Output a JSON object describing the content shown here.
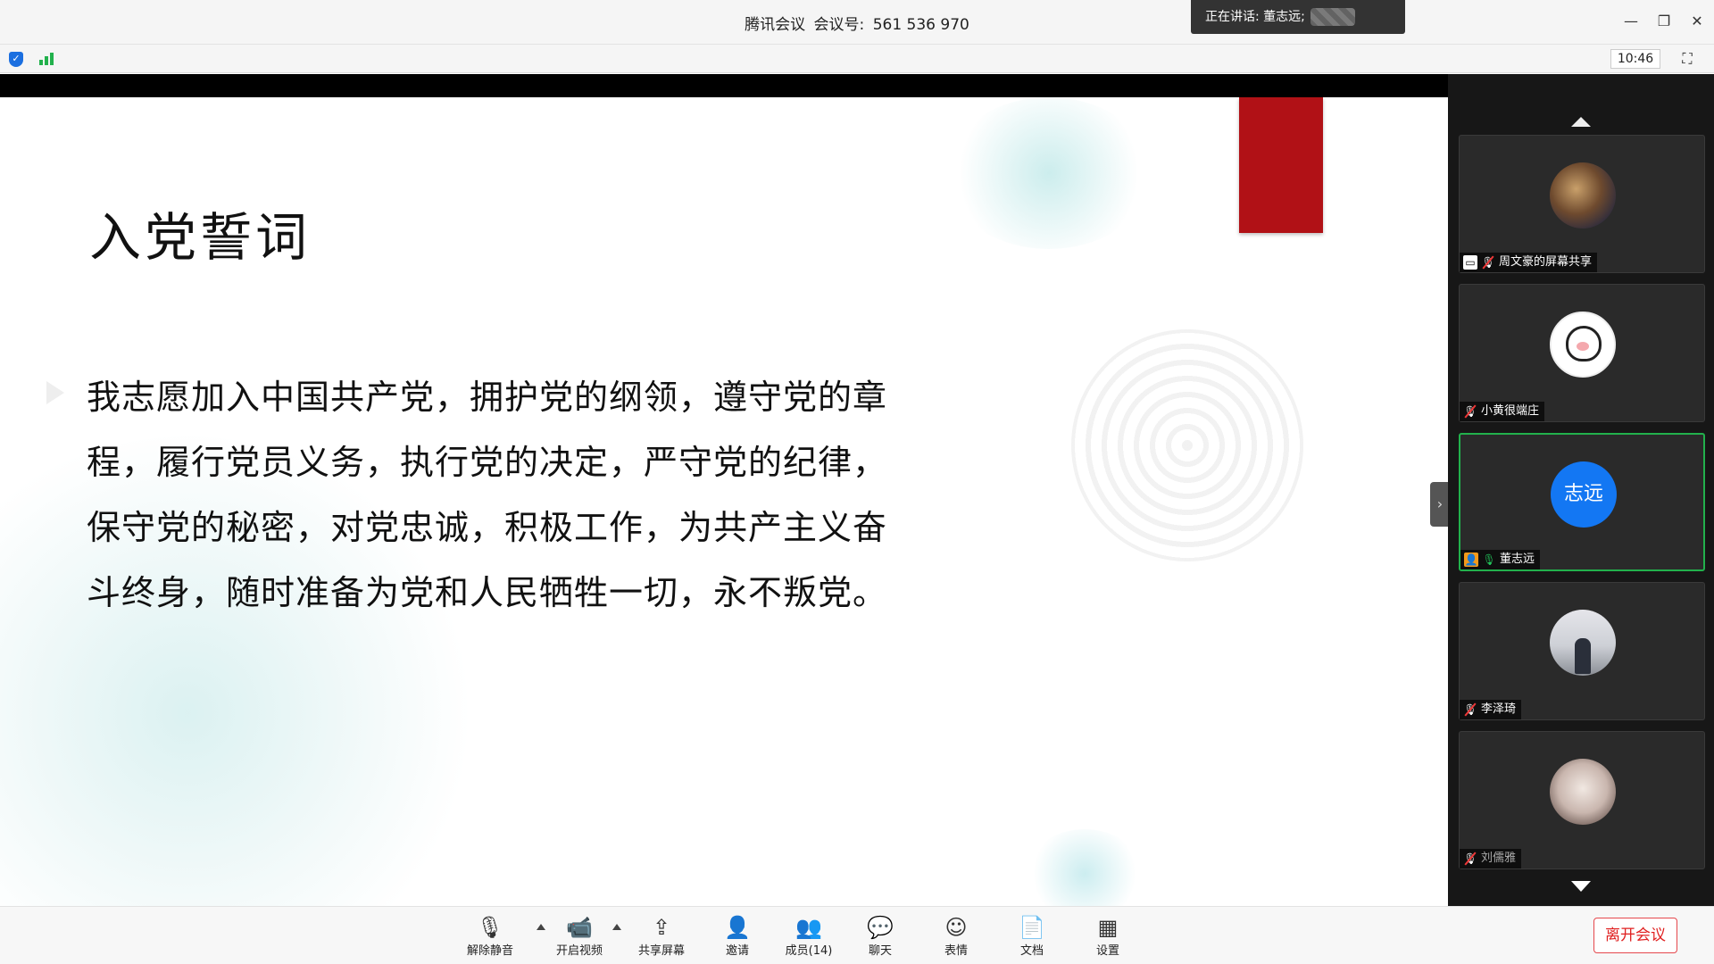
{
  "window": {
    "app_name": "腾讯会议",
    "meeting_label": "会议号:",
    "meeting_id": "561 536 970",
    "speaking_label": "正在讲话: 董志远;",
    "minimize": "—",
    "restore": "❐",
    "close": "✕"
  },
  "infobar": {
    "time": "10:46",
    "fullscreen_icon": "⛶"
  },
  "slide": {
    "title": "入党誓词",
    "body_lines": [
      "我志愿加入中国共产党，拥护党的纲领，遵守党的章",
      "程，履行党员义务，执行党的决定，严守党的纪律，",
      "保守党的秘密，对党忠诚，积极工作，为共产主义奋",
      "斗终身，随时准备为党和人民牺牲一切，永不叛党。"
    ],
    "ribbon_color": "#b11116"
  },
  "participants": [
    {
      "name": "周文豪的屏幕共享",
      "mic": "muted",
      "sharing": true,
      "avatar": "photo"
    },
    {
      "name": "小黄很端庄",
      "mic": "muted",
      "avatar": "cartoon"
    },
    {
      "name": "董志远",
      "mic": "on",
      "active": true,
      "avatar_text": "志远",
      "avatar_color": "#1377f3"
    },
    {
      "name": "李泽琦",
      "mic": "muted",
      "avatar": "photo"
    },
    {
      "name": "刘儒雅",
      "mic": "muted",
      "avatar": "photo"
    }
  ],
  "toolbar": {
    "unmute": "解除静音",
    "start_video": "开启视频",
    "share_screen": "共享屏幕",
    "invite": "邀请",
    "members": "成员(14)",
    "chat": "聊天",
    "reactions": "表情",
    "docs": "文档",
    "settings": "设置",
    "leave": "离开会议"
  },
  "colors": {
    "accent_blue": "#1377f3",
    "active_green": "#22b14c",
    "leave_red": "#e02020"
  }
}
